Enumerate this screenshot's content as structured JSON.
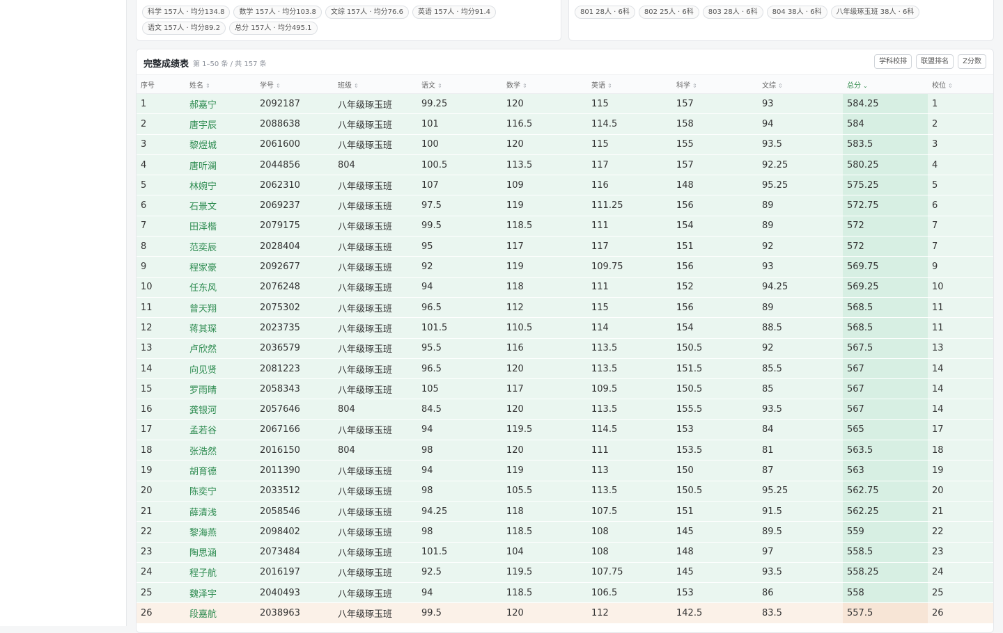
{
  "summary_left": {
    "chips": [
      "科学 157人 · 均分134.8",
      "数学 157人 · 均分103.8",
      "文综 157人 · 均分76.6",
      "英语 157人 · 均分91.4",
      "语文 157人 · 均分89.2",
      "总分 157人 · 均分495.1"
    ]
  },
  "summary_right": {
    "chips": [
      "801 28人 · 6科",
      "802 25人 · 6科",
      "803 28人 · 6科",
      "804 38人 · 6科",
      "八年级琢玉班 38人 · 6科"
    ]
  },
  "table_panel": {
    "title": "完整成绩表",
    "subtitle": "第 1–50 条 / 共 157 条",
    "buttons": [
      "学科校排",
      "联盟排名",
      "Z分数"
    ],
    "columns": [
      "序号",
      "姓名",
      "学号",
      "班级",
      "语文",
      "数学",
      "英语",
      "科学",
      "文综",
      "总分",
      "校位"
    ],
    "sort_marks": [
      "",
      "⇕",
      "⇕",
      "⇕",
      "⇕",
      "⇕",
      "⇕",
      "⇕",
      "⇕",
      "⌄",
      "⇕"
    ],
    "rows": [
      [
        "1",
        "郝嘉宁",
        "2092187",
        "八年级琢玉班",
        "99.25",
        "120",
        "115",
        "157",
        "93",
        "584.25",
        "1"
      ],
      [
        "2",
        "唐宇辰",
        "2088638",
        "八年级琢玉班",
        "101",
        "116.5",
        "114.5",
        "158",
        "94",
        "584",
        "2"
      ],
      [
        "3",
        "黎煜城",
        "2061600",
        "八年级琢玉班",
        "100",
        "120",
        "115",
        "155",
        "93.5",
        "583.5",
        "3"
      ],
      [
        "4",
        "唐听澜",
        "2044856",
        "804",
        "100.5",
        "113.5",
        "117",
        "157",
        "92.25",
        "580.25",
        "4"
      ],
      [
        "5",
        "林婉宁",
        "2062310",
        "八年级琢玉班",
        "107",
        "109",
        "116",
        "148",
        "95.25",
        "575.25",
        "5"
      ],
      [
        "6",
        "石景文",
        "2069237",
        "八年级琢玉班",
        "97.5",
        "119",
        "111.25",
        "156",
        "89",
        "572.75",
        "6"
      ],
      [
        "7",
        "田泽楷",
        "2079175",
        "八年级琢玉班",
        "99.5",
        "118.5",
        "111",
        "154",
        "89",
        "572",
        "7"
      ],
      [
        "8",
        "范奕辰",
        "2028404",
        "八年级琢玉班",
        "95",
        "117",
        "117",
        "151",
        "92",
        "572",
        "7"
      ],
      [
        "9",
        "程家豪",
        "2092677",
        "八年级琢玉班",
        "92",
        "119",
        "109.75",
        "156",
        "93",
        "569.75",
        "9"
      ],
      [
        "10",
        "任东风",
        "2076248",
        "八年级琢玉班",
        "94",
        "118",
        "111",
        "152",
        "94.25",
        "569.25",
        "10"
      ],
      [
        "11",
        "曾天翔",
        "2075302",
        "八年级琢玉班",
        "96.5",
        "112",
        "115",
        "156",
        "89",
        "568.5",
        "11"
      ],
      [
        "12",
        "蒋其琛",
        "2023735",
        "八年级琢玉班",
        "101.5",
        "110.5",
        "114",
        "154",
        "88.5",
        "568.5",
        "11"
      ],
      [
        "13",
        "卢欣然",
        "2036579",
        "八年级琢玉班",
        "95.5",
        "116",
        "113.5",
        "150.5",
        "92",
        "567.5",
        "13"
      ],
      [
        "14",
        "向见贤",
        "2081223",
        "八年级琢玉班",
        "96.5",
        "120",
        "113.5",
        "151.5",
        "85.5",
        "567",
        "14"
      ],
      [
        "15",
        "罗雨晴",
        "2058343",
        "八年级琢玉班",
        "105",
        "117",
        "109.5",
        "150.5",
        "85",
        "567",
        "14"
      ],
      [
        "16",
        "龚银河",
        "2057646",
        "804",
        "84.5",
        "120",
        "113.5",
        "155.5",
        "93.5",
        "567",
        "14"
      ],
      [
        "17",
        "孟若谷",
        "2067166",
        "八年级琢玉班",
        "94",
        "119.5",
        "114.5",
        "153",
        "84",
        "565",
        "17"
      ],
      [
        "18",
        "张浩然",
        "2016150",
        "804",
        "98",
        "120",
        "111",
        "153.5",
        "81",
        "563.5",
        "18"
      ],
      [
        "19",
        "胡育德",
        "2011390",
        "八年级琢玉班",
        "94",
        "119",
        "113",
        "150",
        "87",
        "563",
        "19"
      ],
      [
        "20",
        "陈奕宁",
        "2033512",
        "八年级琢玉班",
        "98",
        "105.5",
        "113.5",
        "150.5",
        "95.25",
        "562.75",
        "20"
      ],
      [
        "21",
        "薛清浅",
        "2058546",
        "八年级琢玉班",
        "94.25",
        "118",
        "107.5",
        "151",
        "91.5",
        "562.25",
        "21"
      ],
      [
        "22",
        "黎海燕",
        "2098402",
        "八年级琢玉班",
        "98",
        "118.5",
        "108",
        "145",
        "89.5",
        "559",
        "22"
      ],
      [
        "23",
        "陶思涵",
        "2073484",
        "八年级琢玉班",
        "101.5",
        "104",
        "108",
        "148",
        "97",
        "558.5",
        "23"
      ],
      [
        "24",
        "程子航",
        "2016197",
        "八年级琢玉班",
        "92.5",
        "119.5",
        "107.75",
        "145",
        "93.5",
        "558.25",
        "24"
      ],
      [
        "25",
        "魏泽宇",
        "2040493",
        "八年级琢玉班",
        "94",
        "118.5",
        "106.5",
        "153",
        "86",
        "558",
        "25"
      ],
      [
        "26",
        "段嘉航",
        "2038963",
        "八年级琢玉班",
        "99.5",
        "120",
        "112",
        "142.5",
        "83.5",
        "557.5",
        "26"
      ]
    ],
    "colors": {
      "row_green": "#eaf6f0",
      "row_orange": "#fbf1e8",
      "name_green": "#2b8a4e"
    }
  }
}
